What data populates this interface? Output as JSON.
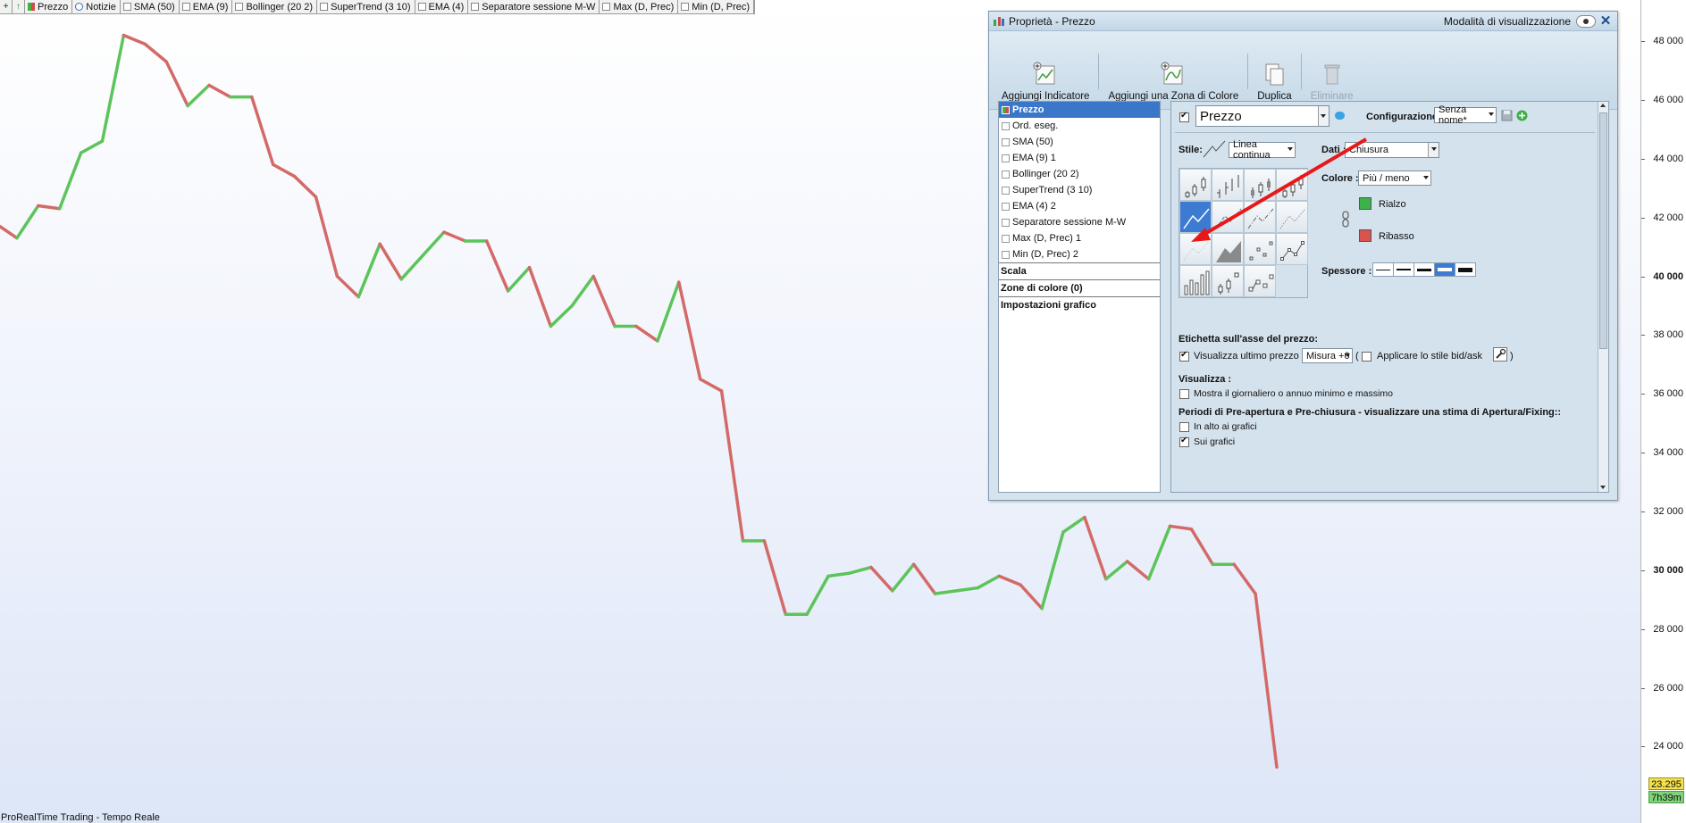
{
  "toolbar": {
    "items": [
      {
        "label": "Prezzo",
        "kind": "swatch"
      },
      {
        "label": "Notizie",
        "kind": "news"
      },
      {
        "label": "SMA (50)",
        "kind": "check"
      },
      {
        "label": "EMA (9)",
        "kind": "check"
      },
      {
        "label": "Bollinger (20 2)",
        "kind": "check"
      },
      {
        "label": "SuperTrend (3 10)",
        "kind": "check"
      },
      {
        "label": "EMA (4)",
        "kind": "check"
      },
      {
        "label": "Separatore sessione M-W",
        "kind": "check"
      },
      {
        "label": "Max (D, Prec)",
        "kind": "check"
      },
      {
        "label": "Min (D, Prec)",
        "kind": "check"
      }
    ]
  },
  "axis": {
    "ticks": [
      {
        "value": 48000,
        "label": "48 000"
      },
      {
        "value": 46000,
        "label": "46 000"
      },
      {
        "value": 44000,
        "label": "44 000"
      },
      {
        "value": 42000,
        "label": "42 000"
      },
      {
        "value": 40000,
        "label": "40 000"
      },
      {
        "value": 38000,
        "label": "38 000"
      },
      {
        "value": 36000,
        "label": "36 000"
      },
      {
        "value": 34000,
        "label": "34 000"
      },
      {
        "value": 32000,
        "label": "32 000"
      },
      {
        "value": 30000,
        "label": "30 000"
      },
      {
        "value": 28000,
        "label": "28 000"
      },
      {
        "value": 26000,
        "label": "26 000"
      },
      {
        "value": 24000,
        "label": "24 000"
      }
    ],
    "last_price": "23.295",
    "countdown": "7h39m"
  },
  "chart_data": {
    "type": "line",
    "ylim": [
      21400,
      49400
    ],
    "up_color": "#5cc45a",
    "down_color": "#d46a68",
    "values": [
      41800,
      41300,
      42400,
      42300,
      44200,
      44600,
      48200,
      47900,
      47300,
      45800,
      46500,
      46100,
      46100,
      43800,
      43400,
      42700,
      40000,
      39300,
      41100,
      39900,
      40700,
      41500,
      41200,
      41200,
      39500,
      40300,
      38300,
      39000,
      40000,
      38300,
      38300,
      37800,
      39800,
      36500,
      36100,
      31000,
      31000,
      28500,
      28500,
      29800,
      29900,
      30100,
      29300,
      30200,
      29200,
      29300,
      29400,
      29800,
      29500,
      28700,
      31300,
      31800,
      29700,
      30300,
      29700,
      31500,
      31400,
      30200,
      30200,
      29200,
      23300
    ]
  },
  "footer": "ProRealTime Trading - Tempo Reale",
  "dialog": {
    "title": "Proprietà - Prezzo",
    "mode_label": "Modalità di visualizzazione",
    "tools": [
      {
        "label": "Aggiungi Indicatore",
        "disabled": false
      },
      {
        "label": "Aggiungi una Zona di Colore",
        "disabled": false
      },
      {
        "label": "Duplica",
        "disabled": false
      },
      {
        "label": "Eliminare",
        "disabled": true
      }
    ],
    "tree": {
      "items": [
        {
          "label": "Prezzo",
          "selected": true
        },
        {
          "label": "Ord. eseg.",
          "selected": false
        },
        {
          "label": "SMA (50)",
          "selected": false
        },
        {
          "label": "EMA (9) 1",
          "selected": false
        },
        {
          "label": "Bollinger (20 2)",
          "selected": false
        },
        {
          "label": "SuperTrend (3 10)",
          "selected": false
        },
        {
          "label": "EMA (4) 2",
          "selected": false
        },
        {
          "label": "Separatore sessione M-W",
          "selected": false
        },
        {
          "label": "Max (D, Prec) 1",
          "selected": false
        },
        {
          "label": "Min (D, Prec) 2",
          "selected": false
        }
      ],
      "sections": [
        "Scala",
        "Zone di colore (0)",
        "Impostazioni grafico"
      ]
    },
    "panel": {
      "series_name": "Prezzo",
      "config_label": "Configurazione:",
      "config_value": "Senza nome*",
      "style_label": "Stile:",
      "style_value": "Linea continua",
      "data_label": "Dati :",
      "data_value": "Chiusura",
      "color_label": "Colore :",
      "color_value": "Più / meno",
      "rise_label": "Rialzo",
      "rise_color": "#3db24a",
      "fall_label": "Ribasso",
      "fall_color": "#d9534f",
      "thickness_label": "Spessore :",
      "price_axis_heading": "Etichetta sull'asse del prezzo:",
      "show_last_price": "Visualizza ultimo prezzo",
      "measure_value": "Misura +0",
      "paren_open": "(",
      "bidask_label": "Applicare lo stile bid/ask",
      "paren_close": ")",
      "display_heading": "Visualizza :",
      "show_minmax": "Mostra il giornaliero o annuo minimo e massimo",
      "preopen_heading": "Periodi di Pre-apertura e Pre-chiusura - visualizzare una stima di Apertura/Fixing::",
      "above_charts": "In alto ai grafici",
      "on_charts": "Sui grafici"
    }
  }
}
